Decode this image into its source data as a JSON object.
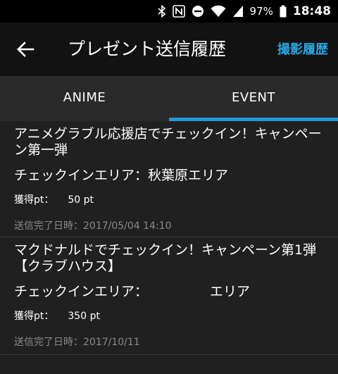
{
  "status_bar": {
    "battery": "97%",
    "time": "18:48"
  },
  "header": {
    "title": "プレゼント送信履歴",
    "history_link": "撮影履歴"
  },
  "tabs": [
    {
      "label": "ANIME",
      "active": false
    },
    {
      "label": "EVENT",
      "active": true
    }
  ],
  "items": [
    {
      "title": "アニメグラブル応援店でチェックイン！キャンペーン第一弾",
      "area_label": "チェックインエリア：",
      "area_name": "秋葉原エリア",
      "points_label": "獲得pt：",
      "points_value": "50 pt",
      "date": "送信完了日時：2017/05/04 14:10"
    },
    {
      "title": "マクドナルドでチェックイン！キャンペーン第1弾【クラブハウス】",
      "area_label": "チェックインエリア：",
      "area_name": "エリア",
      "points_label": "獲得pt：",
      "points_value": "350 pt",
      "date": "送信完了日時：2017/10/11"
    }
  ],
  "colors": {
    "accent": "#1e9ad6",
    "link": "#2ba7e4",
    "background": "#202020",
    "app_bar": "#121212",
    "tab_bar": "#2a2a2a"
  }
}
